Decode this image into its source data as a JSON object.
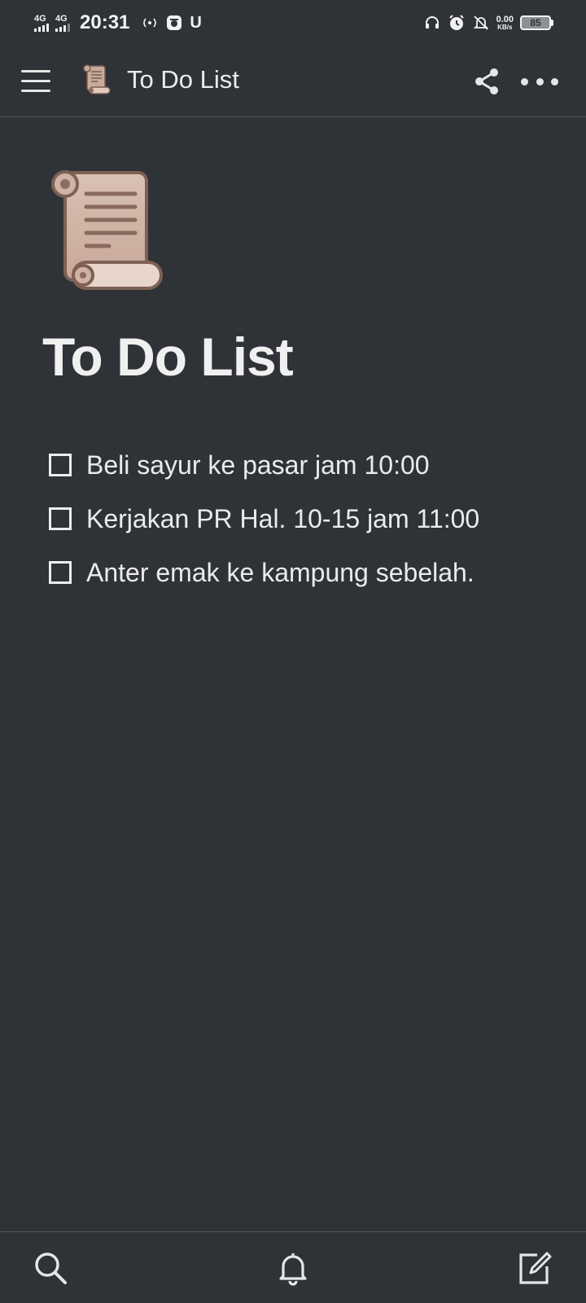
{
  "status_bar": {
    "network1": "4G",
    "network2": "4G",
    "time": "20:31",
    "carrier_glyph": "U",
    "speed_value": "0.00",
    "speed_unit": "KB/s",
    "battery": "85",
    "icons": [
      "hotspot-icon",
      "app-notification-icon",
      "headphones-icon",
      "alarm-icon",
      "notifications-off-icon"
    ]
  },
  "app_bar": {
    "title": "To Do List",
    "icon": "scroll-icon"
  },
  "page": {
    "title": "To Do List",
    "icon": "scroll-icon"
  },
  "todos": [
    {
      "text": "Beli sayur ke pasar jam 10:00",
      "checked": false
    },
    {
      "text": "Kerjakan PR Hal. 10-15 jam 11:00",
      "checked": false
    },
    {
      "text": "Anter emak ke kampung sebelah.",
      "checked": false
    }
  ],
  "bottom_bar": {
    "icons": [
      "search-icon",
      "bell-icon",
      "new-page-icon"
    ]
  },
  "colors": {
    "background": "#2f3337",
    "text": "#ebebeb",
    "divider": "#54585c"
  }
}
